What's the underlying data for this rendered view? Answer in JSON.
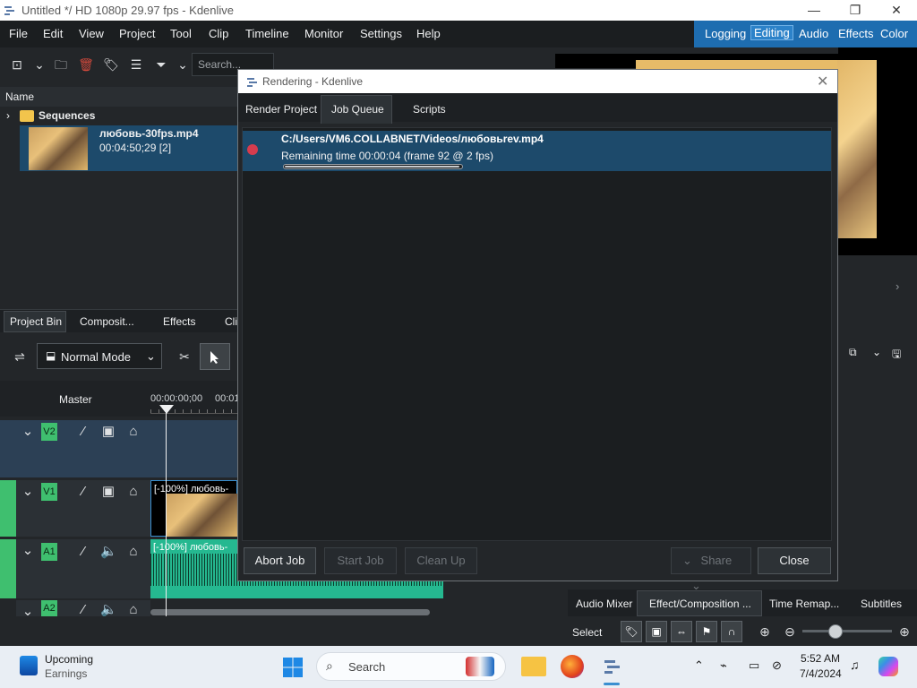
{
  "window": {
    "title": "Untitled */ HD 1080p 29.97 fps - Kdenlive"
  },
  "menu": [
    "File",
    "Edit",
    "View",
    "Project",
    "Tool",
    "Clip",
    "Timeline",
    "Monitor",
    "Settings",
    "Help"
  ],
  "layouts": {
    "items": [
      "Logging",
      "Editing",
      "Audio",
      "Effects",
      "Color"
    ],
    "active": "Editing"
  },
  "bin": {
    "search_placeholder": "Search...",
    "header": "Name",
    "folder": "Sequences",
    "clip": {
      "name": "любовь-30fps.mp4",
      "meta": "00:04:50;29 [2]"
    },
    "tabs": [
      "Project Bin",
      "Composit...",
      "Effects",
      "Cli"
    ]
  },
  "timeline": {
    "mode": "Normal Mode",
    "master_label": "Master",
    "ruler": [
      "00:00:00;00",
      "00:01"
    ],
    "tracks": [
      {
        "name": "V2"
      },
      {
        "name": "V1",
        "clip": "[-100%] любовь-"
      },
      {
        "name": "A1",
        "clip": "[-100%] любовь-"
      },
      {
        "name": "A2"
      }
    ]
  },
  "bottom_tabs": [
    "Audio Mixer",
    "Effect/Composition ...",
    "Time Remap...",
    "Subtitles"
  ],
  "statusbar": {
    "mode": "Select"
  },
  "dialog": {
    "title": "Rendering - Kdenlive",
    "tabs": [
      "Render Project",
      "Job Queue",
      "Scripts"
    ],
    "active_tab": "Job Queue",
    "job": {
      "path": "C:/Users/VM6.COLLABNET/Videos/любовьrev.mp4",
      "remaining": "Remaining time 00:00:04 (frame 92 @ 2 fps)",
      "progress": 0.99,
      "status_color": "#d63c4e"
    },
    "buttons": {
      "abort": "Abort Job",
      "start": "Start Job",
      "clean": "Clean Up",
      "share": "Share",
      "close": "Close"
    }
  },
  "taskbar": {
    "widget_title": "Upcoming",
    "widget_sub": "Earnings",
    "search": "Search",
    "time": "5:52 AM",
    "date": "7/4/2024"
  },
  "colors": {
    "accent": "#1e6db0",
    "selection": "#1d4a6b",
    "track_green": "#3fbf6f",
    "record_red": "#d63c4e"
  }
}
